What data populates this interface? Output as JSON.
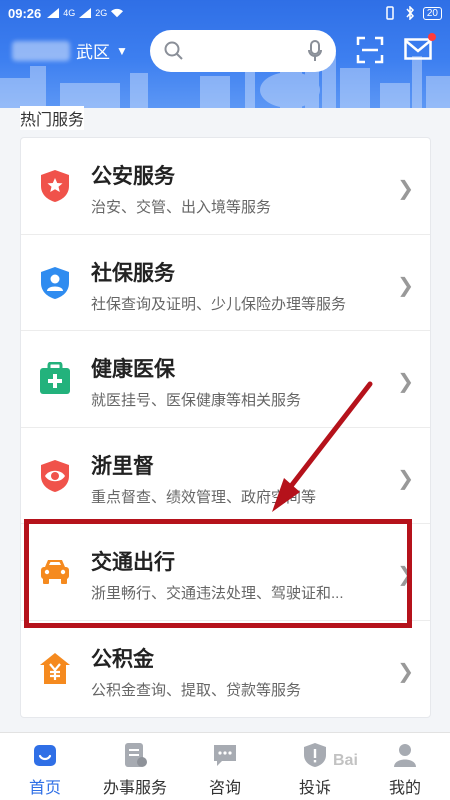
{
  "status_bar": {
    "time": "09:26",
    "network_left": "4G",
    "network_right": "2G",
    "battery": "20"
  },
  "header": {
    "location_suffix": "武区",
    "search": {
      "placeholder": ""
    },
    "colors": {
      "header_blue": "#2f6fe6",
      "notification_dot": "#ff3b3b"
    }
  },
  "section": {
    "title": "热门服务"
  },
  "services": [
    {
      "title": "公安服务",
      "desc": "治安、交管、出入境等服务",
      "icon": "police-star-icon",
      "color": "#f0524a"
    },
    {
      "title": "社保服务",
      "desc": "社保查询及证明、少儿保险办理等服务",
      "icon": "social-security-person-icon",
      "color": "#2f8cf0"
    },
    {
      "title": "健康医保",
      "desc": "就医挂号、医保健康等相关服务",
      "icon": "medical-kit-icon",
      "color": "#23b27c"
    },
    {
      "title": "浙里督",
      "desc": "重点督查、绩效管理、政府空间等",
      "icon": "eye-shield-icon",
      "color": "#f0524a"
    },
    {
      "title": "交通出行",
      "desc": "浙里畅行、交通违法处理、驾驶证和...",
      "icon": "car-icon",
      "color": "#f58a1f"
    },
    {
      "title": "公积金",
      "desc": "公积金查询、提取、贷款等服务",
      "icon": "yuan-house-icon",
      "color": "#f58a1f"
    }
  ],
  "bottom_nav": [
    {
      "label": "首页",
      "icon": "home-icon",
      "active": true
    },
    {
      "label": "办事服务",
      "icon": "service-doc-icon",
      "active": false
    },
    {
      "label": "咨询",
      "icon": "chat-icon",
      "active": false
    },
    {
      "label": "投诉",
      "icon": "complaint-shield-icon",
      "active": false
    },
    {
      "label": "我的",
      "icon": "profile-icon",
      "active": false
    }
  ],
  "annotation": {
    "highlight_color": "#b5121b"
  },
  "watermark": "Bai"
}
